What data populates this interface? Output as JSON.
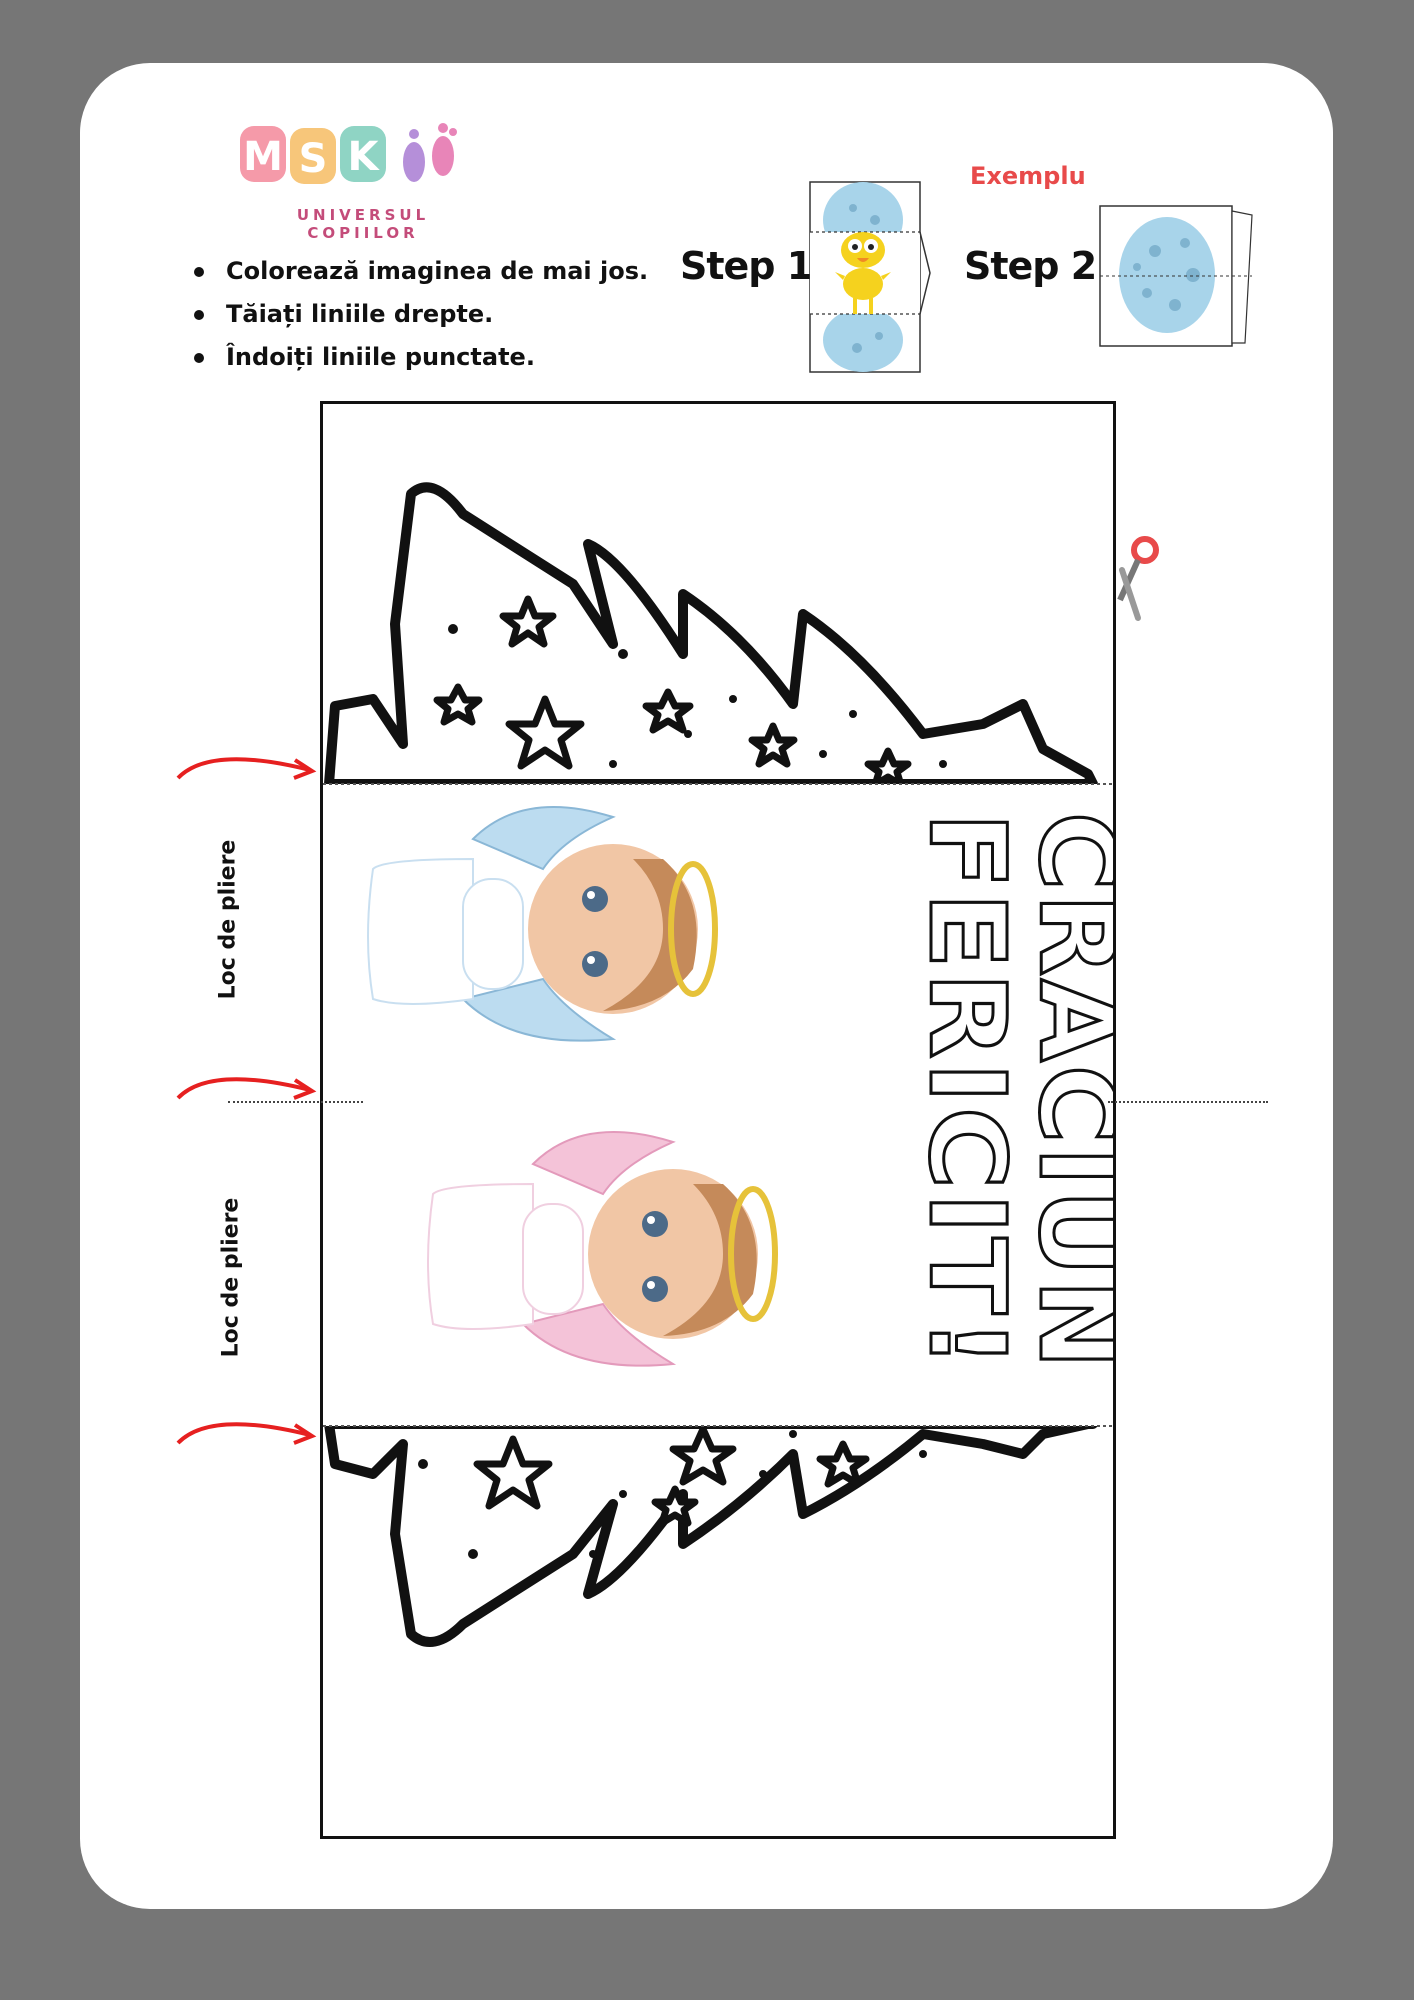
{
  "logo": {
    "text": "MSK",
    "subtitle": "UNIVERSUL COPIILOR"
  },
  "instructions": [
    "Colorează imaginea de mai jos.",
    "Tăiați liniile drepte.",
    "Îndoiți liniile punctate."
  ],
  "example": {
    "label": "Exemplu",
    "step1": "Step 1",
    "step2": "Step 2"
  },
  "fold_labels": [
    "Loc de pliere",
    "Loc de pliere"
  ],
  "card": {
    "title_line1": "CRACIUN",
    "title_line2": "FERICIT!"
  },
  "colors": {
    "accent": "#e84a4a",
    "egg": "#a8d4ea",
    "chick": "#f5d21e",
    "angel_blue": "#bcdcf0",
    "angel_pink": "#f4c3d8"
  }
}
